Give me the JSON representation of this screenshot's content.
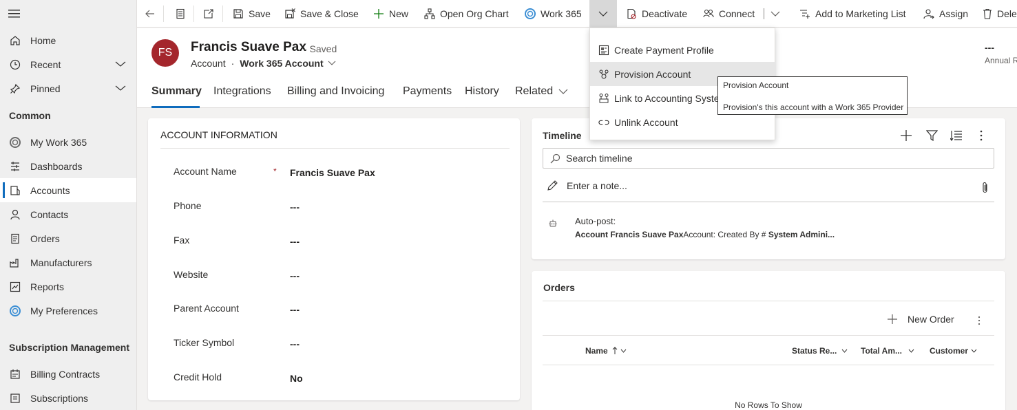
{
  "sidebar": {
    "items": [
      {
        "label": "Home"
      },
      {
        "label": "Recent"
      },
      {
        "label": "Pinned"
      },
      {
        "label": "My Work 365"
      },
      {
        "label": "Dashboards"
      },
      {
        "label": "Accounts"
      },
      {
        "label": "Contacts"
      },
      {
        "label": "Orders"
      },
      {
        "label": "Manufacturers"
      },
      {
        "label": "Reports"
      },
      {
        "label": "My Preferences"
      },
      {
        "label": "Billing Contracts"
      },
      {
        "label": "Subscriptions"
      }
    ],
    "group_common": "Common",
    "group_subscription": "Subscription Management"
  },
  "toolbar": {
    "save": "Save",
    "save_close": "Save & Close",
    "new": "New",
    "org_chart": "Open Org Chart",
    "work365": "Work 365",
    "deactivate": "Deactivate",
    "connect": "Connect",
    "add_marketing": "Add to Marketing List",
    "assign": "Assign",
    "delete": "Delete"
  },
  "dropdown": {
    "items": [
      {
        "label": "Create Payment Profile"
      },
      {
        "label": "Provision Account"
      },
      {
        "label": "Link to Accounting System"
      },
      {
        "label": "Unlink Account"
      }
    ]
  },
  "tooltip": {
    "title": "Provision Account",
    "description": "Provision's this account with a Work 365 Provider"
  },
  "record": {
    "initials": "FS",
    "name": "Francis Suave Pax",
    "status": "- Saved",
    "entity": "Account",
    "form": "Work 365 Account",
    "annual_value": "---",
    "annual_label": "Annual Revenue"
  },
  "tabs": [
    {
      "label": "Summary"
    },
    {
      "label": "Integrations"
    },
    {
      "label": "Billing and Invoicing"
    },
    {
      "label": "Payments"
    },
    {
      "label": "History"
    },
    {
      "label": "Related"
    }
  ],
  "account_info": {
    "title": "ACCOUNT INFORMATION",
    "fields": [
      {
        "label": "Account Name",
        "value": "Francis Suave Pax",
        "required_mark": "*"
      },
      {
        "label": "Phone",
        "value": "---"
      },
      {
        "label": "Fax",
        "value": "---"
      },
      {
        "label": "Website",
        "value": "---"
      },
      {
        "label": "Parent Account",
        "value": "---"
      },
      {
        "label": "Ticker Symbol",
        "value": "---"
      },
      {
        "label": "Credit Hold",
        "value": "No"
      }
    ]
  },
  "timeline": {
    "title": "Timeline",
    "search_placeholder": "Search timeline",
    "note_placeholder": "Enter a note...",
    "post_label": "Auto-post:",
    "post_bold": "Account Francis Suave Pax",
    "post_text": "Account: Created By # ",
    "post_bold2": "System Admini..."
  },
  "orders": {
    "title": "Orders",
    "new_order": "New Order",
    "columns": [
      "Name",
      "Status Re...",
      "Total Am...",
      "Customer"
    ],
    "empty": "No Rows To Show"
  }
}
